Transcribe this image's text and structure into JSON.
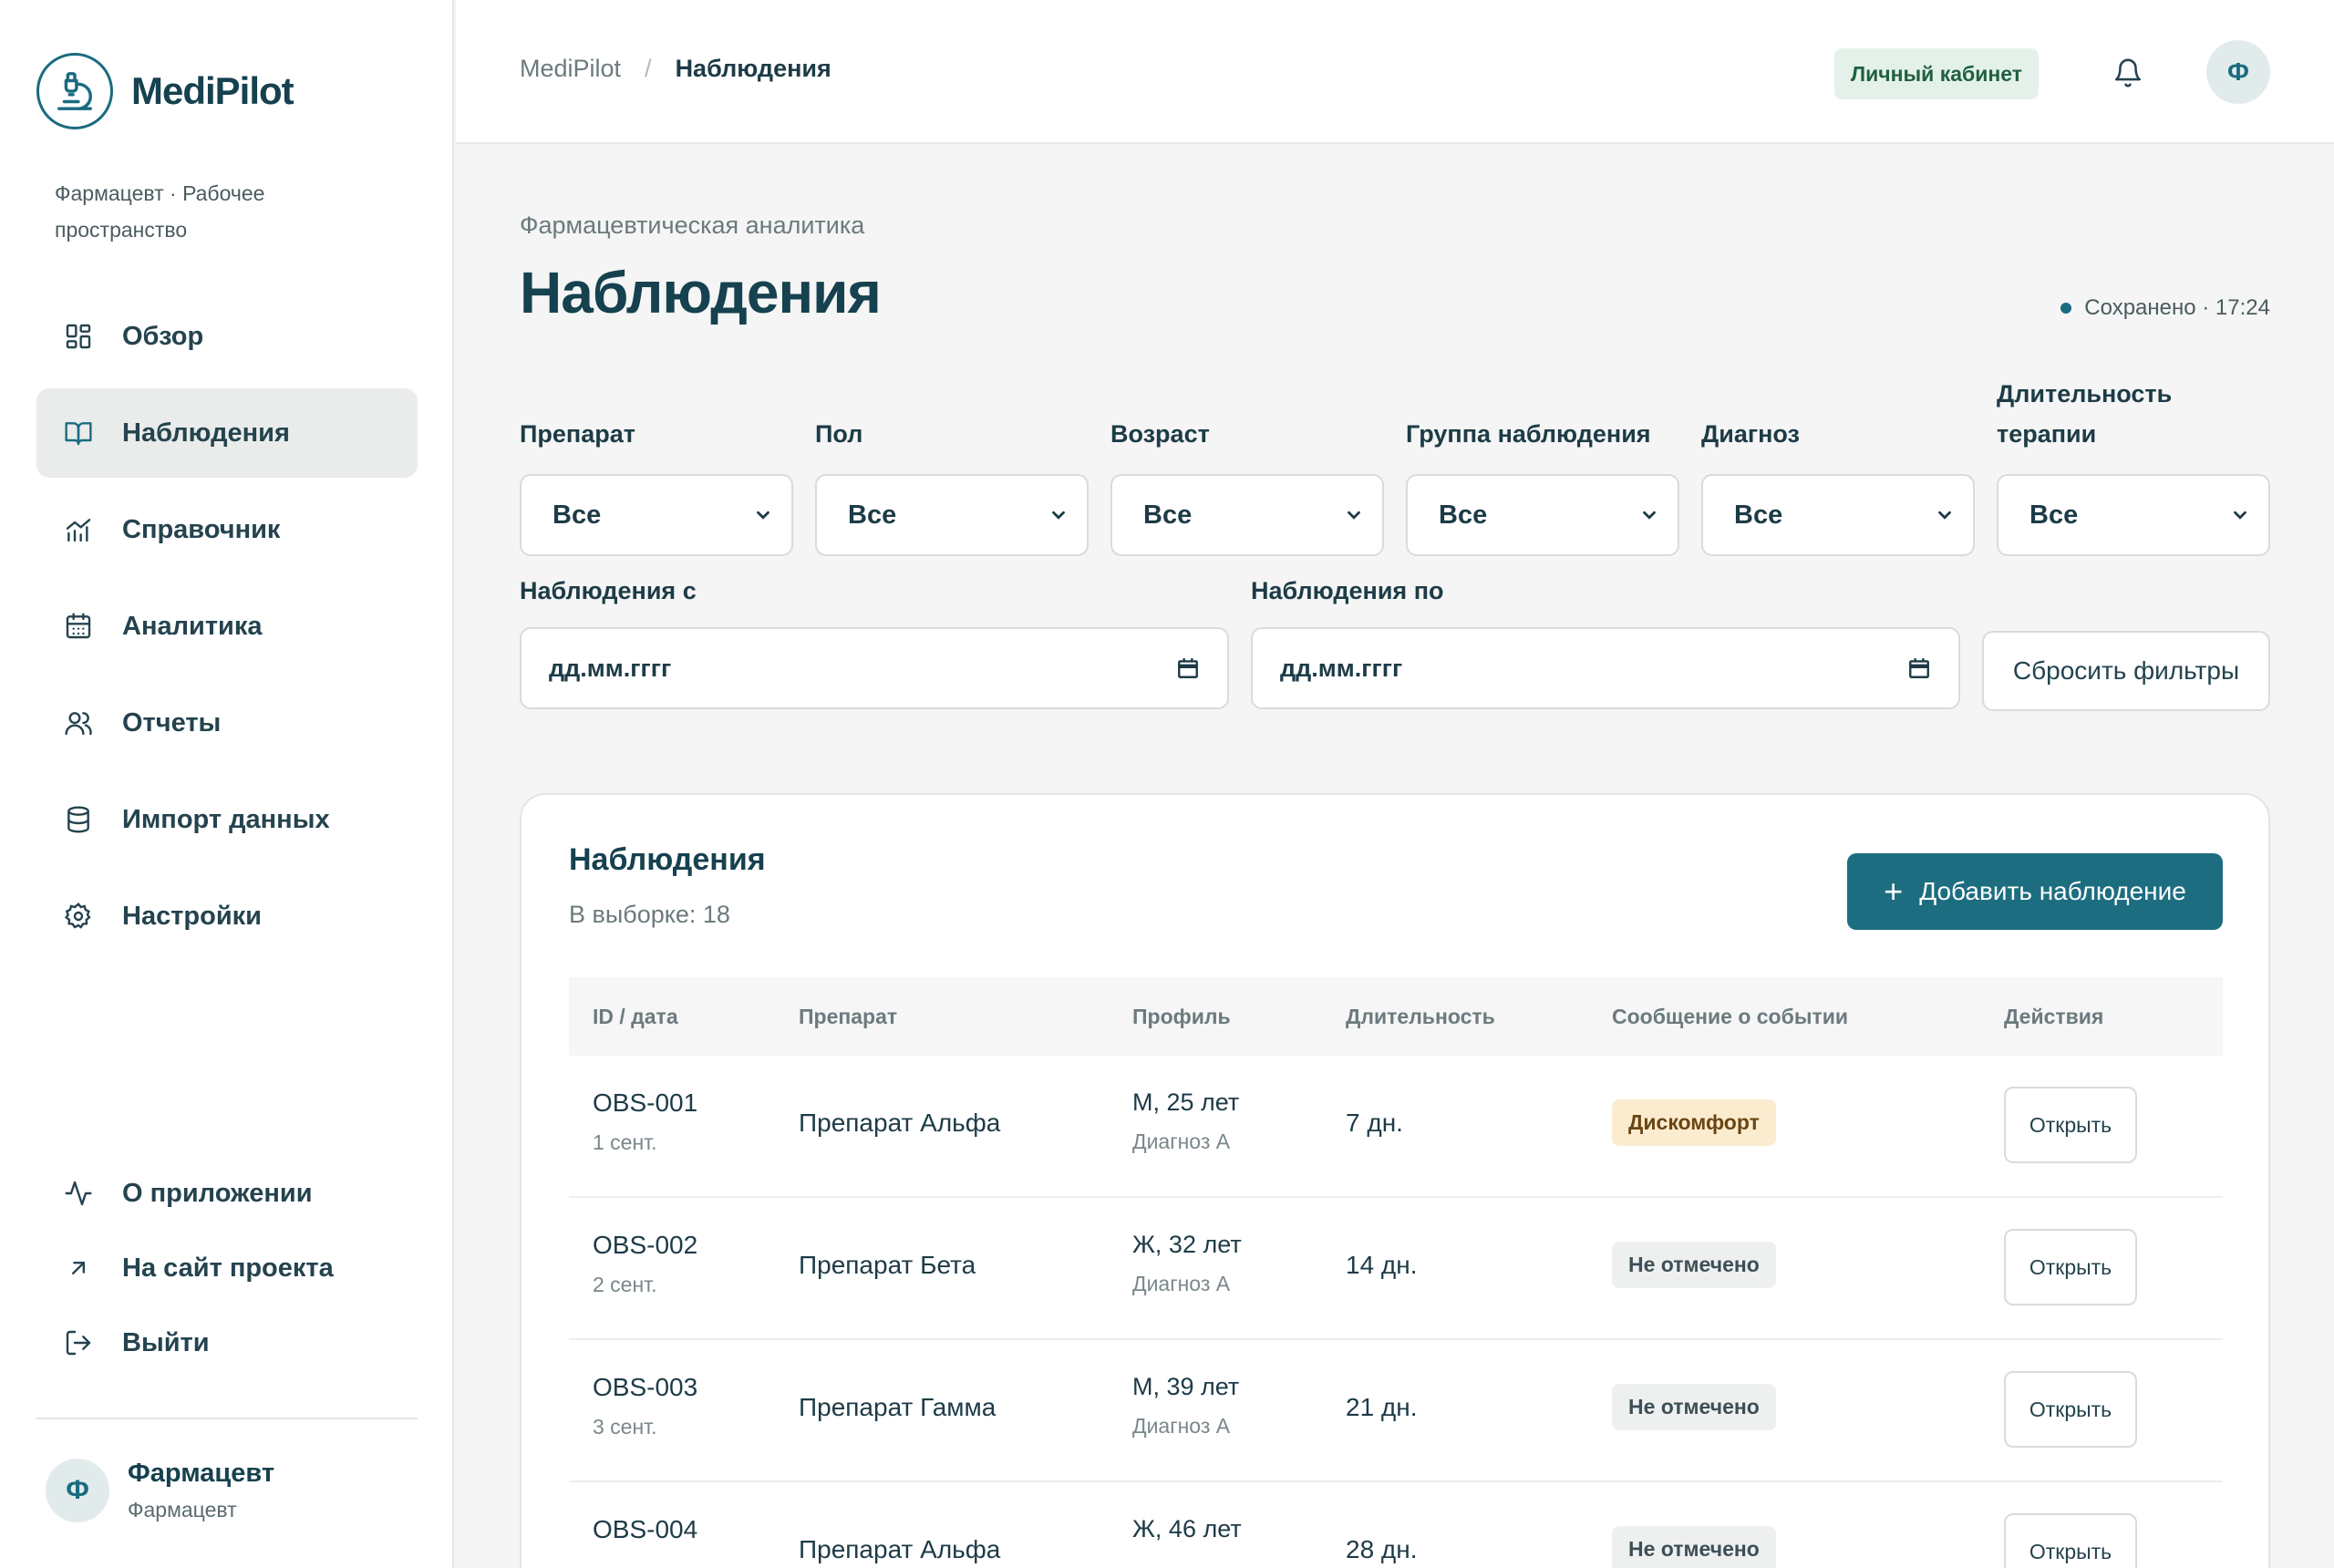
{
  "sidebar": {
    "brand": "MediPilot",
    "workspace": "Фармацевт · Рабочее пространство",
    "items": [
      {
        "label": "Обзор",
        "icon": "grid-icon"
      },
      {
        "label": "Наблюдения",
        "icon": "book-icon",
        "active": true
      },
      {
        "label": "Справочник",
        "icon": "chart-icon"
      },
      {
        "label": "Аналитика",
        "icon": "calendar-icon"
      },
      {
        "label": "Отчеты",
        "icon": "users-icon"
      },
      {
        "label": "Импорт данных",
        "icon": "database-icon"
      },
      {
        "label": "Настройки",
        "icon": "gear-icon"
      }
    ],
    "bottom": [
      {
        "label": "О приложении",
        "icon": "pulse-icon"
      },
      {
        "label": "На сайт проекта",
        "icon": "arrow-up-right-icon"
      },
      {
        "label": "Выйти",
        "icon": "logout-icon"
      }
    ],
    "user": {
      "initial": "Ф",
      "name": "Фармацевт",
      "role": "Фармацевт"
    }
  },
  "topbar": {
    "breadcrumb": [
      "MediPilot",
      "Наблюдения"
    ],
    "cabinet": "Личный кабинет",
    "avatar_initial": "Ф"
  },
  "page": {
    "kicker": "Фармацевтическая аналитика",
    "title": "Наблюдения",
    "saved": "Сохранено · 17:24"
  },
  "filters": {
    "selects": [
      {
        "label": "Препарат",
        "value": "Все"
      },
      {
        "label": "Пол",
        "value": "Все"
      },
      {
        "label": "Возраст",
        "value": "Все"
      },
      {
        "label": "Группа наблюдения",
        "value": "Все"
      },
      {
        "label": "Диагноз",
        "value": "Все"
      },
      {
        "label": "Длительность терапии",
        "value": "Все"
      }
    ],
    "date_from": {
      "label": "Наблюдения с",
      "placeholder": "дд.мм.гггг"
    },
    "date_to": {
      "label": "Наблюдения по",
      "placeholder": "дд.мм.гггг"
    },
    "reset": "Сбросить фильтры"
  },
  "card": {
    "title": "Наблюдения",
    "subtitle": "В выборке: 18",
    "add_button": "Добавить наблюдение",
    "columns": [
      "ID / дата",
      "Препарат",
      "Профиль",
      "Длительность",
      "Сообщение о событии",
      "Действия"
    ],
    "rows": [
      {
        "id": "OBS-001",
        "date": "1 сент.",
        "drug": "Препарат Альфа",
        "profile": "М, 25 лет",
        "diagnosis": "Диагноз А",
        "duration": "7 дн.",
        "event": "Дискомфорт",
        "event_type": "warn",
        "action": "Открыть"
      },
      {
        "id": "OBS-002",
        "date": "2 сент.",
        "drug": "Препарат Бета",
        "profile": "Ж, 32 лет",
        "diagnosis": "Диагноз А",
        "duration": "14 дн.",
        "event": "Не отмечено",
        "event_type": "none",
        "action": "Открыть"
      },
      {
        "id": "OBS-003",
        "date": "3 сент.",
        "drug": "Препарат Гамма",
        "profile": "М, 39 лет",
        "diagnosis": "Диагноз А",
        "duration": "21 дн.",
        "event": "Не отмечено",
        "event_type": "none",
        "action": "Открыть"
      },
      {
        "id": "OBS-004",
        "date": "",
        "drug": "Препарат Альфа",
        "profile": "Ж, 46 лет",
        "diagnosis": "",
        "duration": "28 дн.",
        "event": "Не отмечено",
        "event_type": "none",
        "action": "Открыть"
      }
    ]
  },
  "colors": {
    "accent": "#1d6d80",
    "brand": "#16414f",
    "warn_bg": "#fbecd0",
    "ok_bg": "#e4f1ea"
  }
}
